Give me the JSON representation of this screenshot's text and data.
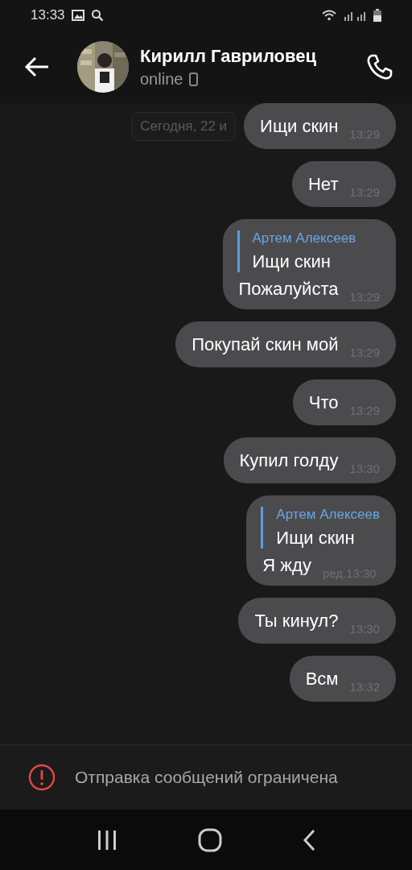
{
  "status_bar": {
    "time": "13:33"
  },
  "header": {
    "name": "Кирилл Гавриловец",
    "status": "online"
  },
  "date_chip": "Сегодня, 22 и",
  "messages": [
    {
      "kind": "text",
      "text": "Ищи скин",
      "time": "13:29"
    },
    {
      "kind": "text",
      "text": "Нет",
      "time": "13:29"
    },
    {
      "kind": "reply",
      "quote_author": "Артем Алексеев",
      "quote_text": "Ищи скин",
      "text": "Пожалуйста",
      "time": "13:29"
    },
    {
      "kind": "text",
      "text": "Покупай скин мой",
      "time": "13:29"
    },
    {
      "kind": "text",
      "text": "Что",
      "time": "13:29"
    },
    {
      "kind": "text",
      "text": "Купил голду",
      "time": "13:30"
    },
    {
      "kind": "reply",
      "quote_author": "Артем Алексеев",
      "quote_text": "Ищи скин",
      "text": "Я жду",
      "edited": "ред.",
      "time": "13:30"
    },
    {
      "kind": "text",
      "text": "Ты кинул?",
      "time": "13:30"
    },
    {
      "kind": "text",
      "text": "Всм",
      "time": "13:32"
    }
  ],
  "notice": {
    "text": "Отправка сообщений ограничена"
  }
}
